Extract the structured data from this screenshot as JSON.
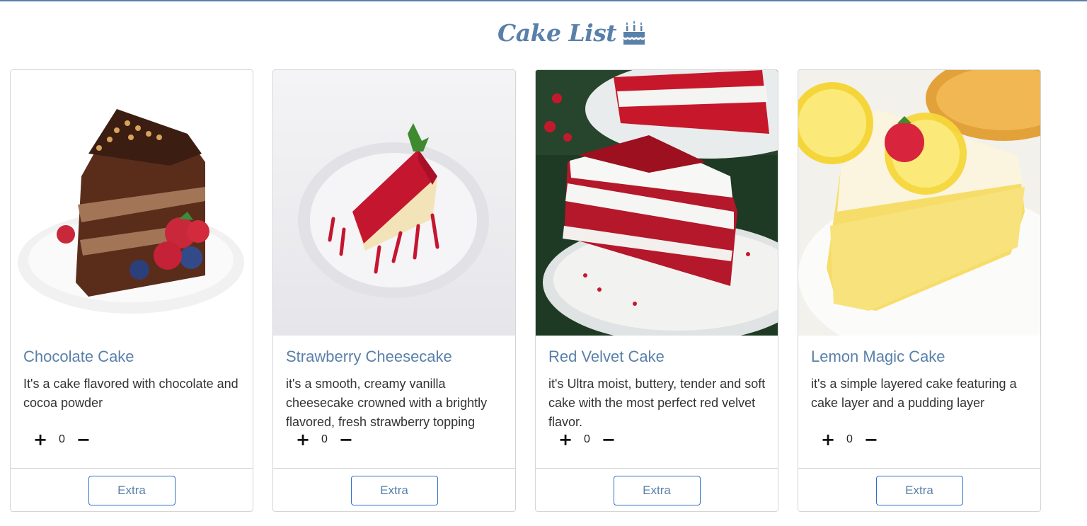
{
  "header": {
    "title": "Cake List"
  },
  "cards": [
    {
      "title": "Chocolate Cake",
      "description": "It's a cake flavored with chocolate and cocoa powder",
      "quantity": "0",
      "plus": "+",
      "minus": "−",
      "button": "Extra"
    },
    {
      "title": "Strawberry Cheesecake",
      "description": "it's a smooth, creamy vanilla cheesecake crowned with a brightly flavored, fresh strawberry topping",
      "quantity": "0",
      "plus": "+",
      "minus": "−",
      "button": "Extra"
    },
    {
      "title": "Red Velvet Cake",
      "description": "it's Ultra moist, buttery, tender and soft cake with the most perfect red velvet flavor.",
      "quantity": "0",
      "plus": "+",
      "minus": "−",
      "button": "Extra"
    },
    {
      "title": "Lemon Magic Cake",
      "description": "it's a simple layered cake featuring a cake layer and a pudding layer",
      "quantity": "0",
      "plus": "+",
      "minus": "−",
      "button": "Extra"
    }
  ],
  "colors": {
    "accent": "#5a80aa",
    "button_border": "#2f6fc7",
    "card_border": "#d5d5d5"
  },
  "icons": {
    "header": "birthday-cake-icon"
  }
}
